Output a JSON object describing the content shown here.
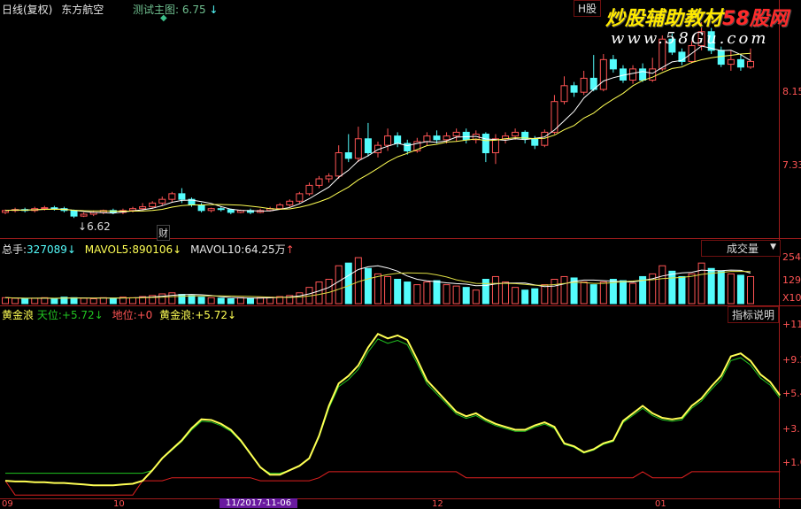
{
  "header": {
    "period": "日线(复权)",
    "stock": "东方航空",
    "main_chart_name": "测试主图:",
    "main_chart_value": "6.75",
    "h_button": "H股",
    "watermark_line1": "炒股辅助教材",
    "watermark_58": "58股网",
    "watermark_url": "www.58Gu.com"
  },
  "price_panel": {
    "low_label": "6.62",
    "cai_label": "财",
    "ticks": [
      "8.15",
      "7.33"
    ]
  },
  "volume_panel": {
    "total_label": "总手:",
    "total_value": "327089",
    "mavol5_label": "MAVOL5:",
    "mavol5_value": "890106",
    "mavol10_label": "MAVOL10:",
    "mavol10_value": "64.25万",
    "dropdown": "成交量",
    "ticks": [
      "254",
      "129",
      "X10"
    ]
  },
  "indicator_panel": {
    "name": "黄金浪",
    "tianwei_label": "天位:",
    "tianwei_value": "+5.72",
    "diwei_label": "地位:",
    "diwei_value": "+0",
    "huangjin_label": "黄金浪:",
    "huangjin_value": "+5.72",
    "help_button": "指标说明",
    "ticks": [
      "+11.",
      "+9.2",
      "+5.4",
      "+3.",
      "+1.0"
    ]
  },
  "date_axis": {
    "labels": [
      "09",
      "10",
      "11/2017-11-06",
      "12",
      "01"
    ],
    "highlight": "11/2017-11-06"
  },
  "colors": {
    "up": "#ff5454",
    "down": "#54fcfc",
    "grid": "#a01c1c",
    "yellow_line": "#ffff54",
    "green_line": "#21c321",
    "red_line": "#e02020"
  },
  "chart_data": {
    "candles": [
      [
        6.66,
        6.68,
        6.64,
        6.69
      ],
      [
        6.68,
        6.69,
        6.66,
        6.71
      ],
      [
        6.69,
        6.68,
        6.66,
        6.71
      ],
      [
        6.68,
        6.7,
        6.66,
        6.72
      ],
      [
        6.7,
        6.71,
        6.68,
        6.73
      ],
      [
        6.71,
        6.7,
        6.68,
        6.73
      ],
      [
        6.7,
        6.68,
        6.66,
        6.72
      ],
      [
        6.68,
        6.62,
        6.6,
        6.69
      ],
      [
        6.62,
        6.64,
        6.61,
        6.66
      ],
      [
        6.64,
        6.66,
        6.62,
        6.68
      ],
      [
        6.66,
        6.68,
        6.64,
        6.69
      ],
      [
        6.68,
        6.66,
        6.64,
        6.7
      ],
      [
        6.66,
        6.68,
        6.64,
        6.7
      ],
      [
        6.68,
        6.7,
        6.66,
        6.72
      ],
      [
        6.7,
        6.72,
        6.68,
        6.76
      ],
      [
        6.72,
        6.76,
        6.7,
        6.78
      ],
      [
        6.76,
        6.8,
        6.73,
        6.83
      ],
      [
        6.8,
        6.86,
        6.77,
        6.88
      ],
      [
        6.86,
        6.8,
        6.76,
        6.92
      ],
      [
        6.8,
        6.74,
        6.72,
        6.82
      ],
      [
        6.74,
        6.68,
        6.66,
        6.76
      ],
      [
        6.68,
        6.7,
        6.66,
        6.71
      ],
      [
        6.7,
        6.69,
        6.67,
        6.72
      ],
      [
        6.69,
        6.66,
        6.64,
        6.7
      ],
      [
        6.66,
        6.68,
        6.65,
        6.69
      ],
      [
        6.68,
        6.66,
        6.64,
        6.7
      ],
      [
        6.66,
        6.68,
        6.65,
        6.7
      ],
      [
        6.68,
        6.7,
        6.67,
        6.72
      ],
      [
        6.7,
        6.74,
        6.69,
        6.76
      ],
      [
        6.74,
        6.78,
        6.72,
        6.8
      ],
      [
        6.78,
        6.86,
        6.76,
        6.88
      ],
      [
        6.86,
        6.95,
        6.84,
        6.98
      ],
      [
        6.95,
        7.02,
        6.92,
        7.05
      ],
      [
        7.02,
        7.05,
        6.98,
        7.08
      ],
      [
        7.05,
        7.3,
        7.02,
        7.38
      ],
      [
        7.3,
        7.24,
        7.2,
        7.5
      ],
      [
        7.24,
        7.45,
        7.2,
        7.58
      ],
      [
        7.45,
        7.3,
        7.26,
        7.62
      ],
      [
        7.3,
        7.38,
        7.25,
        7.42
      ],
      [
        7.38,
        7.48,
        7.32,
        7.56
      ],
      [
        7.48,
        7.4,
        7.36,
        7.52
      ],
      [
        7.4,
        7.32,
        7.28,
        7.44
      ],
      [
        7.32,
        7.42,
        7.3,
        7.46
      ],
      [
        7.42,
        7.48,
        7.38,
        7.52
      ],
      [
        7.48,
        7.44,
        7.4,
        7.54
      ],
      [
        7.44,
        7.48,
        7.4,
        7.52
      ],
      [
        7.48,
        7.52,
        7.42,
        7.56
      ],
      [
        7.52,
        7.44,
        7.4,
        7.56
      ],
      [
        7.44,
        7.5,
        7.4,
        7.54
      ],
      [
        7.5,
        7.3,
        7.2,
        7.52
      ],
      [
        7.3,
        7.45,
        7.18,
        7.5
      ],
      [
        7.45,
        7.48,
        7.4,
        7.52
      ],
      [
        7.48,
        7.52,
        7.44,
        7.56
      ],
      [
        7.52,
        7.45,
        7.4,
        7.54
      ],
      [
        7.45,
        7.38,
        7.34,
        7.48
      ],
      [
        7.38,
        7.52,
        7.36,
        7.55
      ],
      [
        7.52,
        7.85,
        7.5,
        7.92
      ],
      [
        7.85,
        8.02,
        7.82,
        8.12
      ],
      [
        8.02,
        7.95,
        7.9,
        8.06
      ],
      [
        7.95,
        8.1,
        7.92,
        8.18
      ],
      [
        8.1,
        7.98,
        7.96,
        8.35
      ],
      [
        7.98,
        8.3,
        7.96,
        8.36
      ],
      [
        8.3,
        8.2,
        8.16,
        8.35
      ],
      [
        8.2,
        8.08,
        8.05,
        8.24
      ],
      [
        8.08,
        8.2,
        8.04,
        8.24
      ],
      [
        8.2,
        8.08,
        8.06,
        8.26
      ],
      [
        8.08,
        8.2,
        8.06,
        8.32
      ],
      [
        8.2,
        8.52,
        8.18,
        8.56
      ],
      [
        8.52,
        8.38,
        8.35,
        8.58
      ],
      [
        8.38,
        8.28,
        8.24,
        8.42
      ],
      [
        8.28,
        8.45,
        8.26,
        8.5
      ],
      [
        8.45,
        8.6,
        8.4,
        8.7
      ],
      [
        8.6,
        8.4,
        8.36,
        8.64
      ],
      [
        8.4,
        8.25,
        8.22,
        8.44
      ],
      [
        8.25,
        8.3,
        8.18,
        8.4
      ],
      [
        8.3,
        8.22,
        8.18,
        8.36
      ],
      [
        8.22,
        8.28,
        8.2,
        8.42
      ]
    ],
    "volume": [
      22,
      20,
      18,
      20,
      22,
      18,
      24,
      22,
      20,
      18,
      22,
      20,
      24,
      22,
      26,
      30,
      36,
      40,
      34,
      30,
      24,
      22,
      20,
      18,
      22,
      20,
      22,
      24,
      26,
      30,
      40,
      60,
      80,
      90,
      140,
      150,
      170,
      130,
      110,
      100,
      90,
      80,
      70,
      80,
      85,
      70,
      65,
      60,
      50,
      90,
      100,
      80,
      60,
      50,
      55,
      70,
      90,
      100,
      95,
      80,
      70,
      80,
      90,
      85,
      75,
      100,
      110,
      140,
      120,
      100,
      110,
      150,
      130,
      120,
      110,
      105,
      100
    ],
    "yellow": [
      1.5,
      1.45,
      1.45,
      1.4,
      1.4,
      1.35,
      1.35,
      1.3,
      1.25,
      1.2,
      1.2,
      1.2,
      1.25,
      1.3,
      1.5,
      2.2,
      3.0,
      3.6,
      4.2,
      5.0,
      5.6,
      5.55,
      5.3,
      4.9,
      4.2,
      3.3,
      2.4,
      1.9,
      1.9,
      2.2,
      2.5,
      3.0,
      4.5,
      6.5,
      8.0,
      8.5,
      9.2,
      10.4,
      11.3,
      11.0,
      11.2,
      10.9,
      9.6,
      8.2,
      7.5,
      6.8,
      6.1,
      5.8,
      6.0,
      5.6,
      5.3,
      5.1,
      4.9,
      4.9,
      5.2,
      5.4,
      5.1,
      4.0,
      3.8,
      3.4,
      3.6,
      4.0,
      4.2,
      5.5,
      6.0,
      6.5,
      6.0,
      5.7,
      5.6,
      5.7,
      6.5,
      7.0,
      7.8,
      8.5,
      9.8,
      10.0,
      9.5,
      8.6,
      8.1,
      7.2
    ]
  }
}
